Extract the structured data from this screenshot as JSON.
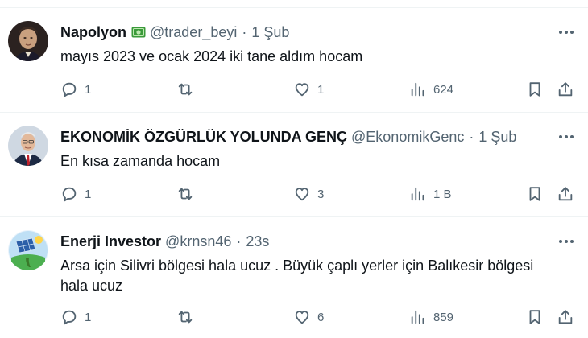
{
  "tweets": [
    {
      "name": "Napolyon",
      "badge": "money-icon",
      "handle": "@trader_beyi",
      "separator": "·",
      "time": "1 Şub",
      "text": "mayıs 2023 ve ocak 2024 iki tane aldım hocam",
      "replies": "1",
      "retweets": "",
      "likes": "1",
      "views": "624",
      "avatar": "napoleon-portrait-avatar"
    },
    {
      "name": "EKONOMİK ÖZGÜRLÜK YOLUNDA GENÇ",
      "handle": "@EkonomikGenc",
      "separator": "·",
      "time": "1 Şub",
      "text": "En kısa zamanda hocam",
      "replies": "1",
      "retweets": "",
      "likes": "3",
      "views": "1 B",
      "avatar": "businessman-portrait-avatar"
    },
    {
      "name": "Enerji Investor",
      "handle": "@krnsn46",
      "separator": "·",
      "time": "23s",
      "text_line1": "Arsa için Silivri bölgesi hala ucuz . Büyük çaplı yerler için Balıkesir bölgesi",
      "text_line2": "hala ucuz",
      "replies": "1",
      "retweets": "",
      "likes": "6",
      "views": "859",
      "avatar": "solar-panel-avatar"
    }
  ],
  "colors": {
    "text": "#0f1419",
    "muted": "#536471",
    "divider": "#eff3f4",
    "money_badge": "#3a9a3a"
  }
}
